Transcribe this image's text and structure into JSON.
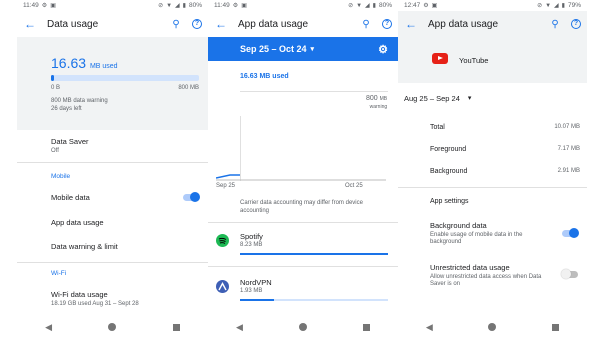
{
  "panel1": {
    "status": {
      "time": "11:49",
      "battery": "80%"
    },
    "title": "Data usage",
    "used_value": "16.63",
    "used_unit": "MB used",
    "usage_fraction": 0.021,
    "range_start": "0 B",
    "range_end": "800 MB",
    "warning_line1": "800 MB data warning",
    "warning_line2": "26 days left",
    "data_saver_label": "Data Saver",
    "data_saver_value": "Off",
    "section_mobile": "Mobile",
    "mobile_data_label": "Mobile data",
    "mobile_data_on": true,
    "app_data_usage_label": "App data usage",
    "warning_limit_label": "Data warning & limit",
    "section_wifi": "Wi-Fi",
    "wifi_usage_label": "Wi-Fi data usage",
    "wifi_usage_sub": "18.19 GB used Aug 31 – Sept 28"
  },
  "panel2": {
    "status": {
      "time": "11:49",
      "battery": "80%"
    },
    "title": "App data usage",
    "period": "Sep 25 – Oct 24",
    "used": "16.63 MB used",
    "warn_value": "800",
    "warn_unit": "MB",
    "warn_label": "warning",
    "x_start": "Sep 25",
    "x_end": "Oct 25",
    "note": "Carrier data accounting may differ from device accounting",
    "apps": [
      {
        "name": "Spotify",
        "amount": "8.23 MB",
        "fraction": 1.0,
        "color": "#1db954"
      },
      {
        "name": "NordVPN",
        "amount": "1.93 MB",
        "fraction": 0.23,
        "color": "#3e5fb5"
      }
    ]
  },
  "panel3": {
    "status": {
      "time": "12:47",
      "battery": "79%"
    },
    "title": "App data usage",
    "app_name": "YouTube",
    "period": "Aug 25 – Sep 24",
    "total_label": "Total",
    "total_value": "10.07 MB",
    "fg_label": "Foreground",
    "fg_value": "7.17 MB",
    "bg_label": "Background",
    "bg_value": "2.91 MB",
    "settings_header": "App settings",
    "bg_data_label": "Background data",
    "bg_data_sub": "Enable usage of mobile data in the background",
    "bg_data_on": true,
    "unrestricted_label": "Unrestricted data usage",
    "unrestricted_sub": "Allow unrestricted data access when Data Saver is on",
    "unrestricted_on": false
  },
  "icons": {
    "back": "arrow-back-icon",
    "search": "search-icon",
    "help": "help-icon",
    "settings": "gear-icon",
    "dropdown": "dropdown-icon"
  },
  "colors": {
    "accent": "#1a73e8",
    "youtube": "#e62117"
  }
}
